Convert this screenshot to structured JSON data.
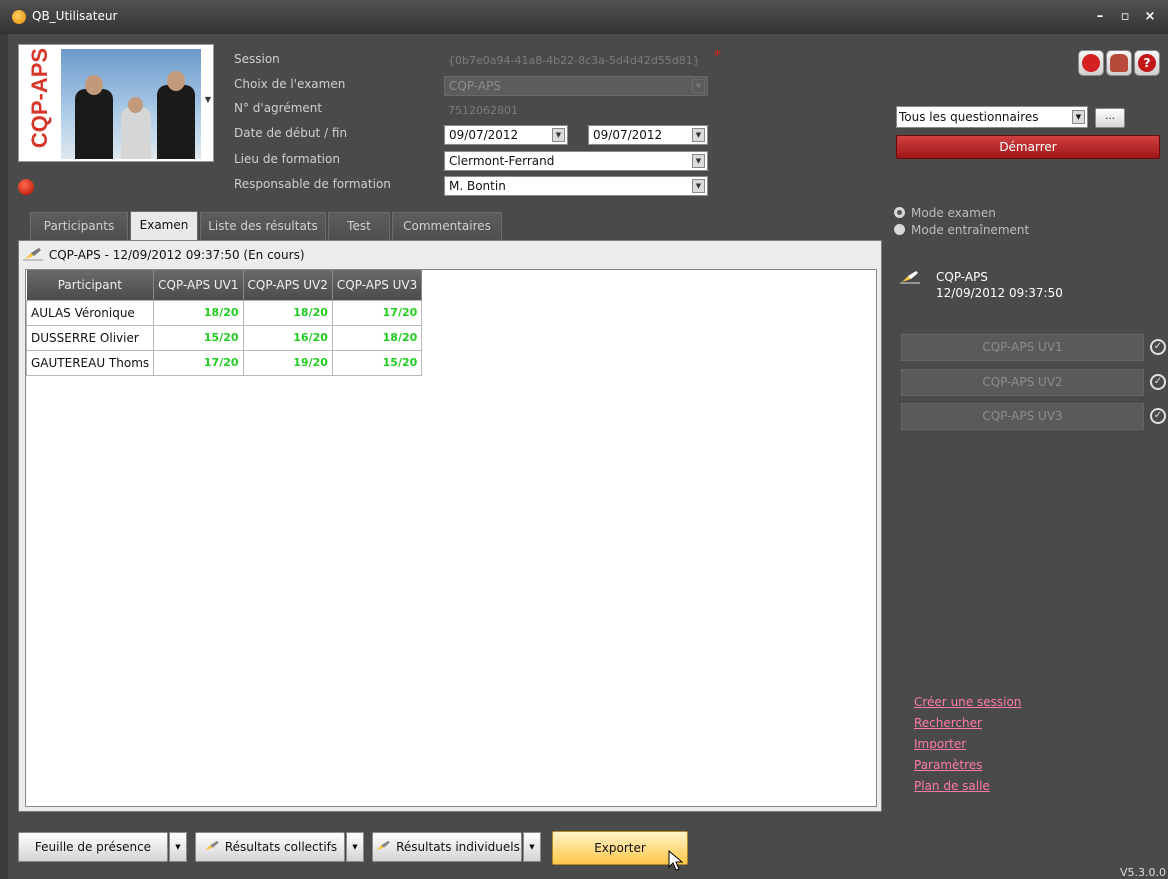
{
  "window": {
    "title": "QB_Utilisateur"
  },
  "logo": {
    "text": "CQP-APS"
  },
  "form": {
    "session_label": "Session",
    "session_value": "{0b7e0a94-41a8-4b22-8c3a-5d4d42d55d81}",
    "required_mark": "*",
    "exam_label": "Choix de l'examen",
    "exam_value": "CQP-APS",
    "agrement_label": "N° d'agrément",
    "agrement_value": "7512062801",
    "dates_label": "Date de début / fin",
    "date_start": "09/07/2012",
    "date_end": "09/07/2012",
    "lieu_label": "Lieu de formation",
    "lieu_value": "Clermont-Ferrand",
    "resp_label": "Responsable de formation",
    "resp_value": "M. Bontin"
  },
  "tabs": [
    "Participants",
    "Examen",
    "Liste des résultats",
    "Test",
    "Commentaires"
  ],
  "active_tab": "Examen",
  "panel": {
    "header": "CQP-APS - 12/09/2012 09:37:50 (En cours)",
    "columns": [
      "Participant",
      "CQP-APS UV1",
      "CQP-APS UV2",
      "CQP-APS UV3"
    ],
    "rows": [
      [
        "AULAS Véronique",
        "18/20",
        "18/20",
        "17/20"
      ],
      [
        "DUSSERRE Olivier",
        "15/20",
        "16/20",
        "18/20"
      ],
      [
        "GAUTEREAU Thoms",
        "17/20",
        "19/20",
        "15/20"
      ]
    ]
  },
  "right": {
    "questionnaire": "Tous les questionnaires",
    "dots": "...",
    "start": "Démarrer",
    "mode_exam": "Mode examen",
    "mode_train": "Mode entraînement",
    "exam_name": "CQP-APS",
    "exam_date": "12/09/2012 09:37:50",
    "uv_buttons": [
      "CQP-APS UV1",
      "CQP-APS UV2",
      "CQP-APS UV3"
    ],
    "links": [
      "Créer une session",
      "Rechercher",
      "Importer",
      "Paramètres",
      "Plan de salle"
    ]
  },
  "bottom": {
    "feuille": "Feuille de présence",
    "collectifs": "Résultats collectifs",
    "individuels": "Résultats individuels",
    "exporter": "Exporter",
    "version": "V5.3.0.0"
  },
  "colors": {
    "accent": "#c0282a",
    "score": "#22cc22",
    "link": "#ff7aa8"
  }
}
